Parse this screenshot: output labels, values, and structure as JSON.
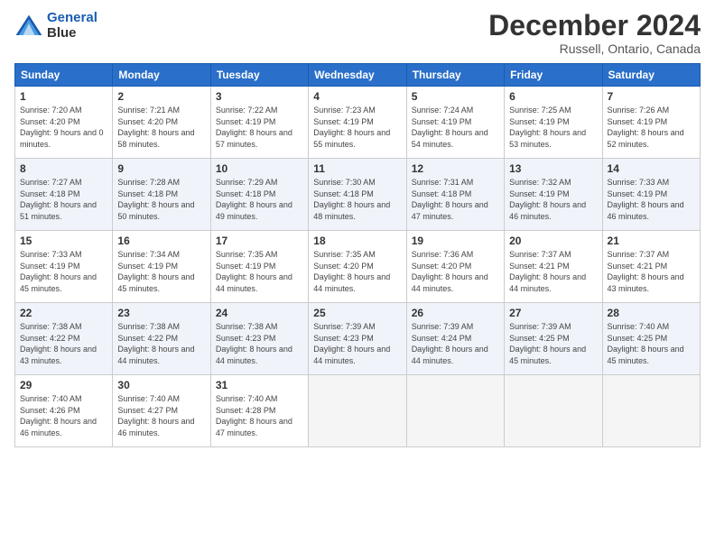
{
  "header": {
    "logo_line1": "General",
    "logo_line2": "Blue",
    "month": "December 2024",
    "location": "Russell, Ontario, Canada"
  },
  "days_of_week": [
    "Sunday",
    "Monday",
    "Tuesday",
    "Wednesday",
    "Thursday",
    "Friday",
    "Saturday"
  ],
  "weeks": [
    [
      {
        "day": 1,
        "sunrise": "Sunrise: 7:20 AM",
        "sunset": "Sunset: 4:20 PM",
        "daylight": "Daylight: 9 hours and 0 minutes."
      },
      {
        "day": 2,
        "sunrise": "Sunrise: 7:21 AM",
        "sunset": "Sunset: 4:20 PM",
        "daylight": "Daylight: 8 hours and 58 minutes."
      },
      {
        "day": 3,
        "sunrise": "Sunrise: 7:22 AM",
        "sunset": "Sunset: 4:19 PM",
        "daylight": "Daylight: 8 hours and 57 minutes."
      },
      {
        "day": 4,
        "sunrise": "Sunrise: 7:23 AM",
        "sunset": "Sunset: 4:19 PM",
        "daylight": "Daylight: 8 hours and 55 minutes."
      },
      {
        "day": 5,
        "sunrise": "Sunrise: 7:24 AM",
        "sunset": "Sunset: 4:19 PM",
        "daylight": "Daylight: 8 hours and 54 minutes."
      },
      {
        "day": 6,
        "sunrise": "Sunrise: 7:25 AM",
        "sunset": "Sunset: 4:19 PM",
        "daylight": "Daylight: 8 hours and 53 minutes."
      },
      {
        "day": 7,
        "sunrise": "Sunrise: 7:26 AM",
        "sunset": "Sunset: 4:19 PM",
        "daylight": "Daylight: 8 hours and 52 minutes."
      }
    ],
    [
      {
        "day": 8,
        "sunrise": "Sunrise: 7:27 AM",
        "sunset": "Sunset: 4:18 PM",
        "daylight": "Daylight: 8 hours and 51 minutes."
      },
      {
        "day": 9,
        "sunrise": "Sunrise: 7:28 AM",
        "sunset": "Sunset: 4:18 PM",
        "daylight": "Daylight: 8 hours and 50 minutes."
      },
      {
        "day": 10,
        "sunrise": "Sunrise: 7:29 AM",
        "sunset": "Sunset: 4:18 PM",
        "daylight": "Daylight: 8 hours and 49 minutes."
      },
      {
        "day": 11,
        "sunrise": "Sunrise: 7:30 AM",
        "sunset": "Sunset: 4:18 PM",
        "daylight": "Daylight: 8 hours and 48 minutes."
      },
      {
        "day": 12,
        "sunrise": "Sunrise: 7:31 AM",
        "sunset": "Sunset: 4:18 PM",
        "daylight": "Daylight: 8 hours and 47 minutes."
      },
      {
        "day": 13,
        "sunrise": "Sunrise: 7:32 AM",
        "sunset": "Sunset: 4:19 PM",
        "daylight": "Daylight: 8 hours and 46 minutes."
      },
      {
        "day": 14,
        "sunrise": "Sunrise: 7:33 AM",
        "sunset": "Sunset: 4:19 PM",
        "daylight": "Daylight: 8 hours and 46 minutes."
      }
    ],
    [
      {
        "day": 15,
        "sunrise": "Sunrise: 7:33 AM",
        "sunset": "Sunset: 4:19 PM",
        "daylight": "Daylight: 8 hours and 45 minutes."
      },
      {
        "day": 16,
        "sunrise": "Sunrise: 7:34 AM",
        "sunset": "Sunset: 4:19 PM",
        "daylight": "Daylight: 8 hours and 45 minutes."
      },
      {
        "day": 17,
        "sunrise": "Sunrise: 7:35 AM",
        "sunset": "Sunset: 4:19 PM",
        "daylight": "Daylight: 8 hours and 44 minutes."
      },
      {
        "day": 18,
        "sunrise": "Sunrise: 7:35 AM",
        "sunset": "Sunset: 4:20 PM",
        "daylight": "Daylight: 8 hours and 44 minutes."
      },
      {
        "day": 19,
        "sunrise": "Sunrise: 7:36 AM",
        "sunset": "Sunset: 4:20 PM",
        "daylight": "Daylight: 8 hours and 44 minutes."
      },
      {
        "day": 20,
        "sunrise": "Sunrise: 7:37 AM",
        "sunset": "Sunset: 4:21 PM",
        "daylight": "Daylight: 8 hours and 44 minutes."
      },
      {
        "day": 21,
        "sunrise": "Sunrise: 7:37 AM",
        "sunset": "Sunset: 4:21 PM",
        "daylight": "Daylight: 8 hours and 43 minutes."
      }
    ],
    [
      {
        "day": 22,
        "sunrise": "Sunrise: 7:38 AM",
        "sunset": "Sunset: 4:22 PM",
        "daylight": "Daylight: 8 hours and 43 minutes."
      },
      {
        "day": 23,
        "sunrise": "Sunrise: 7:38 AM",
        "sunset": "Sunset: 4:22 PM",
        "daylight": "Daylight: 8 hours and 44 minutes."
      },
      {
        "day": 24,
        "sunrise": "Sunrise: 7:38 AM",
        "sunset": "Sunset: 4:23 PM",
        "daylight": "Daylight: 8 hours and 44 minutes."
      },
      {
        "day": 25,
        "sunrise": "Sunrise: 7:39 AM",
        "sunset": "Sunset: 4:23 PM",
        "daylight": "Daylight: 8 hours and 44 minutes."
      },
      {
        "day": 26,
        "sunrise": "Sunrise: 7:39 AM",
        "sunset": "Sunset: 4:24 PM",
        "daylight": "Daylight: 8 hours and 44 minutes."
      },
      {
        "day": 27,
        "sunrise": "Sunrise: 7:39 AM",
        "sunset": "Sunset: 4:25 PM",
        "daylight": "Daylight: 8 hours and 45 minutes."
      },
      {
        "day": 28,
        "sunrise": "Sunrise: 7:40 AM",
        "sunset": "Sunset: 4:25 PM",
        "daylight": "Daylight: 8 hours and 45 minutes."
      }
    ],
    [
      {
        "day": 29,
        "sunrise": "Sunrise: 7:40 AM",
        "sunset": "Sunset: 4:26 PM",
        "daylight": "Daylight: 8 hours and 46 minutes."
      },
      {
        "day": 30,
        "sunrise": "Sunrise: 7:40 AM",
        "sunset": "Sunset: 4:27 PM",
        "daylight": "Daylight: 8 hours and 46 minutes."
      },
      {
        "day": 31,
        "sunrise": "Sunrise: 7:40 AM",
        "sunset": "Sunset: 4:28 PM",
        "daylight": "Daylight: 8 hours and 47 minutes."
      },
      null,
      null,
      null,
      null
    ]
  ]
}
